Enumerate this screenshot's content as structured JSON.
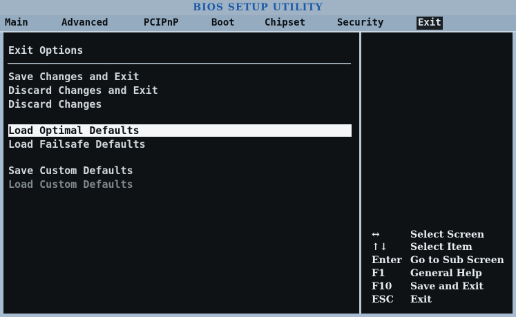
{
  "title": "BIOS SETUP UTILITY",
  "menu": [
    {
      "label": "Main"
    },
    {
      "label": "Advanced"
    },
    {
      "label": "PCIPnP"
    },
    {
      "label": "Boot"
    },
    {
      "label": "Chipset"
    },
    {
      "label": "Security"
    },
    {
      "label": "Exit",
      "active": true
    }
  ],
  "section_title": "Exit Options",
  "options": [
    {
      "label": "Save Changes and Exit"
    },
    {
      "label": "Discard Changes and Exit"
    },
    {
      "label": "Discard Changes"
    },
    {
      "label": "Load Optimal Defaults",
      "selected": true
    },
    {
      "label": "Load Failsafe Defaults"
    },
    {
      "label": "Save Custom Defaults"
    },
    {
      "label": "Load Custom Defaults",
      "disabled": true
    }
  ],
  "help": [
    {
      "key": "↔",
      "desc": "Select Screen"
    },
    {
      "key": "↑↓",
      "desc": "Select Item"
    },
    {
      "key": "Enter",
      "desc": "Go to Sub Screen"
    },
    {
      "key": "F1",
      "desc": "General Help"
    },
    {
      "key": "F10",
      "desc": "Save and Exit"
    },
    {
      "key": "ESC",
      "desc": "Exit"
    }
  ],
  "colors": {
    "title_text": "#1e5aa8",
    "menubar": "#95abbf",
    "background": "#0f1214",
    "highlight": "#f4f6f7"
  }
}
